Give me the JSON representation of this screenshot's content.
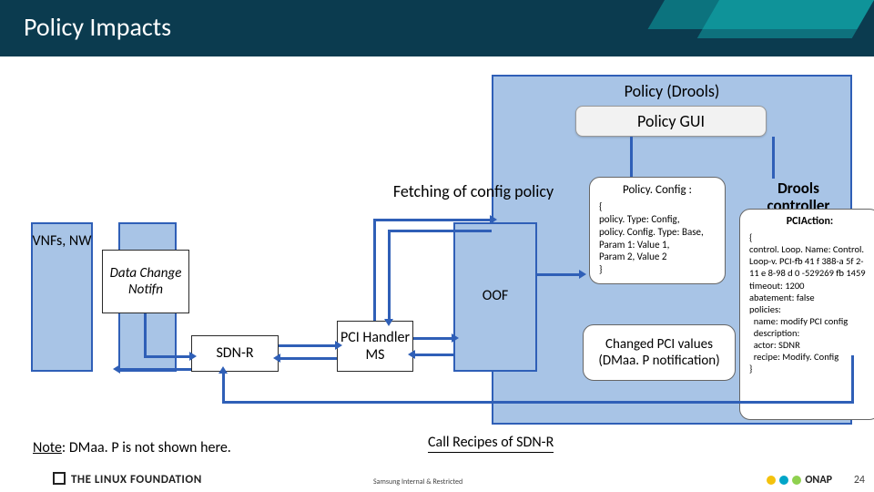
{
  "title": "Policy Impacts",
  "drools": {
    "title": "Policy (Drools)",
    "gui": "Policy GUI",
    "controller": "Drools controller"
  },
  "fetch": "Fetching of config policy",
  "policyConfig": {
    "header": "Policy. Config :",
    "body": "{\npolicy. Type: Config,\npolicy. Config. Type: Base,\nParam 1: Value 1,\nParam 2, Value 2\n}"
  },
  "pciAction": {
    "header": "PCIAction:",
    "body": "{\ncontrol. Loop. Name: Control. Loop-v. PCI-fb 41 f 388-a 5f 2-11 e 8-98 d 0 -529269 fb 1459\ntimeout: 1200\nabatement: false\npolicies:\n  name: modify PCI config\n  description:\n  actor: SDNR\n  recipe: Modify. Config\n}"
  },
  "changed": "Changed PCI values (DMaa. P notification)",
  "vnf": "VNFs, NW",
  "dcn": "Data Change Notifn",
  "sdnr": "SDN-R",
  "pcih": "PCI Handler MS",
  "oof": "OOF",
  "recipes": "Call Recipes of SDN-R",
  "note_u": "Note",
  "note_tail": ": DMaa. P is not shown here.",
  "footer": "THE LINUX FOUNDATION",
  "conf": "Samsung Internal & Restricted",
  "pagenum": "24",
  "onap": "ONAP"
}
